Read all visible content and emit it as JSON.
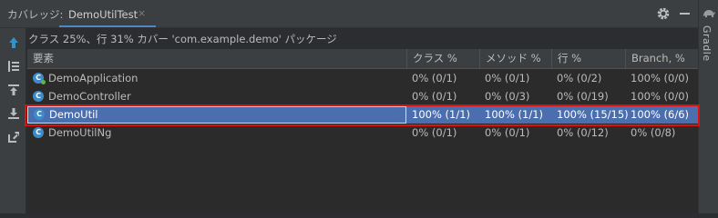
{
  "tool_window": {
    "title": "カバレッジ:",
    "tab_label": "DemoUtilTest",
    "tab_close": "×",
    "side_panel_label": "Gradle"
  },
  "summary": "クラス 25%、行 31% カバー 'com.example.demo' パッケージ",
  "table": {
    "columns": [
      "要素",
      "クラス %",
      "メソッド %",
      "行 %",
      "Branch, %"
    ],
    "rows": [
      {
        "name": "DemoApplication",
        "class": "0% (0/1)",
        "method": "0% (0/1)",
        "line": "0% (0/2)",
        "branch": "100% (0/0)",
        "selected": false,
        "icon": "spring-class-icon"
      },
      {
        "name": "DemoController",
        "class": "0% (0/1)",
        "method": "0% (0/3)",
        "line": "0% (0/19)",
        "branch": "100% (0/0)",
        "selected": false,
        "icon": "class-icon"
      },
      {
        "name": "DemoUtil",
        "class": "100% (1/1)",
        "method": "100% (1/1)",
        "line": "100% (15/15)",
        "branch": "100% (6/6)",
        "selected": true,
        "icon": "class-icon"
      },
      {
        "name": "DemoUtilNg",
        "class": "0% (0/1)",
        "method": "0% (0/1)",
        "line": "0% (0/12)",
        "branch": "0% (0/8)",
        "selected": false,
        "icon": "class-icon"
      }
    ]
  },
  "colors": {
    "selection": "#4b6eaf",
    "highlight_outline": "#e01010",
    "accent": "#4a88c7"
  }
}
